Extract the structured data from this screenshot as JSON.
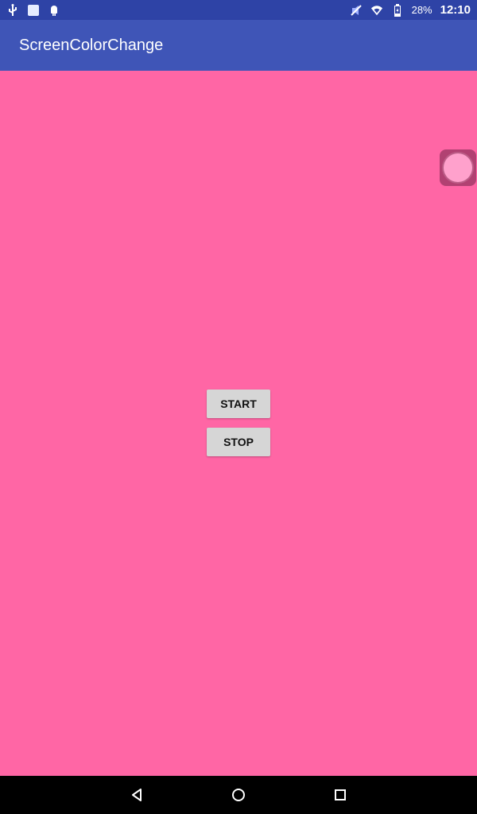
{
  "status_bar": {
    "left_icons": [
      "usb-icon",
      "notification-icon",
      "android-icon"
    ],
    "right_icons": [
      "mute-icon",
      "wifi-icon",
      "battery-icon"
    ],
    "battery_text": "28%",
    "time": "12:10"
  },
  "app_bar": {
    "title": "ScreenColorChange"
  },
  "content": {
    "background_color": "#ff66a5",
    "floating_handle_color": "#b14172",
    "floating_knob_color": "#ffa1cc"
  },
  "buttons": {
    "start_label": "START",
    "stop_label": "STOP"
  },
  "nav_bar": {
    "icons": [
      "back-icon",
      "home-icon",
      "recents-icon"
    ]
  },
  "colors": {
    "status_bar": "#2e43a6",
    "app_bar": "#3f55b7",
    "button_bg": "#d6d6d6",
    "nav_bar": "#000000"
  }
}
